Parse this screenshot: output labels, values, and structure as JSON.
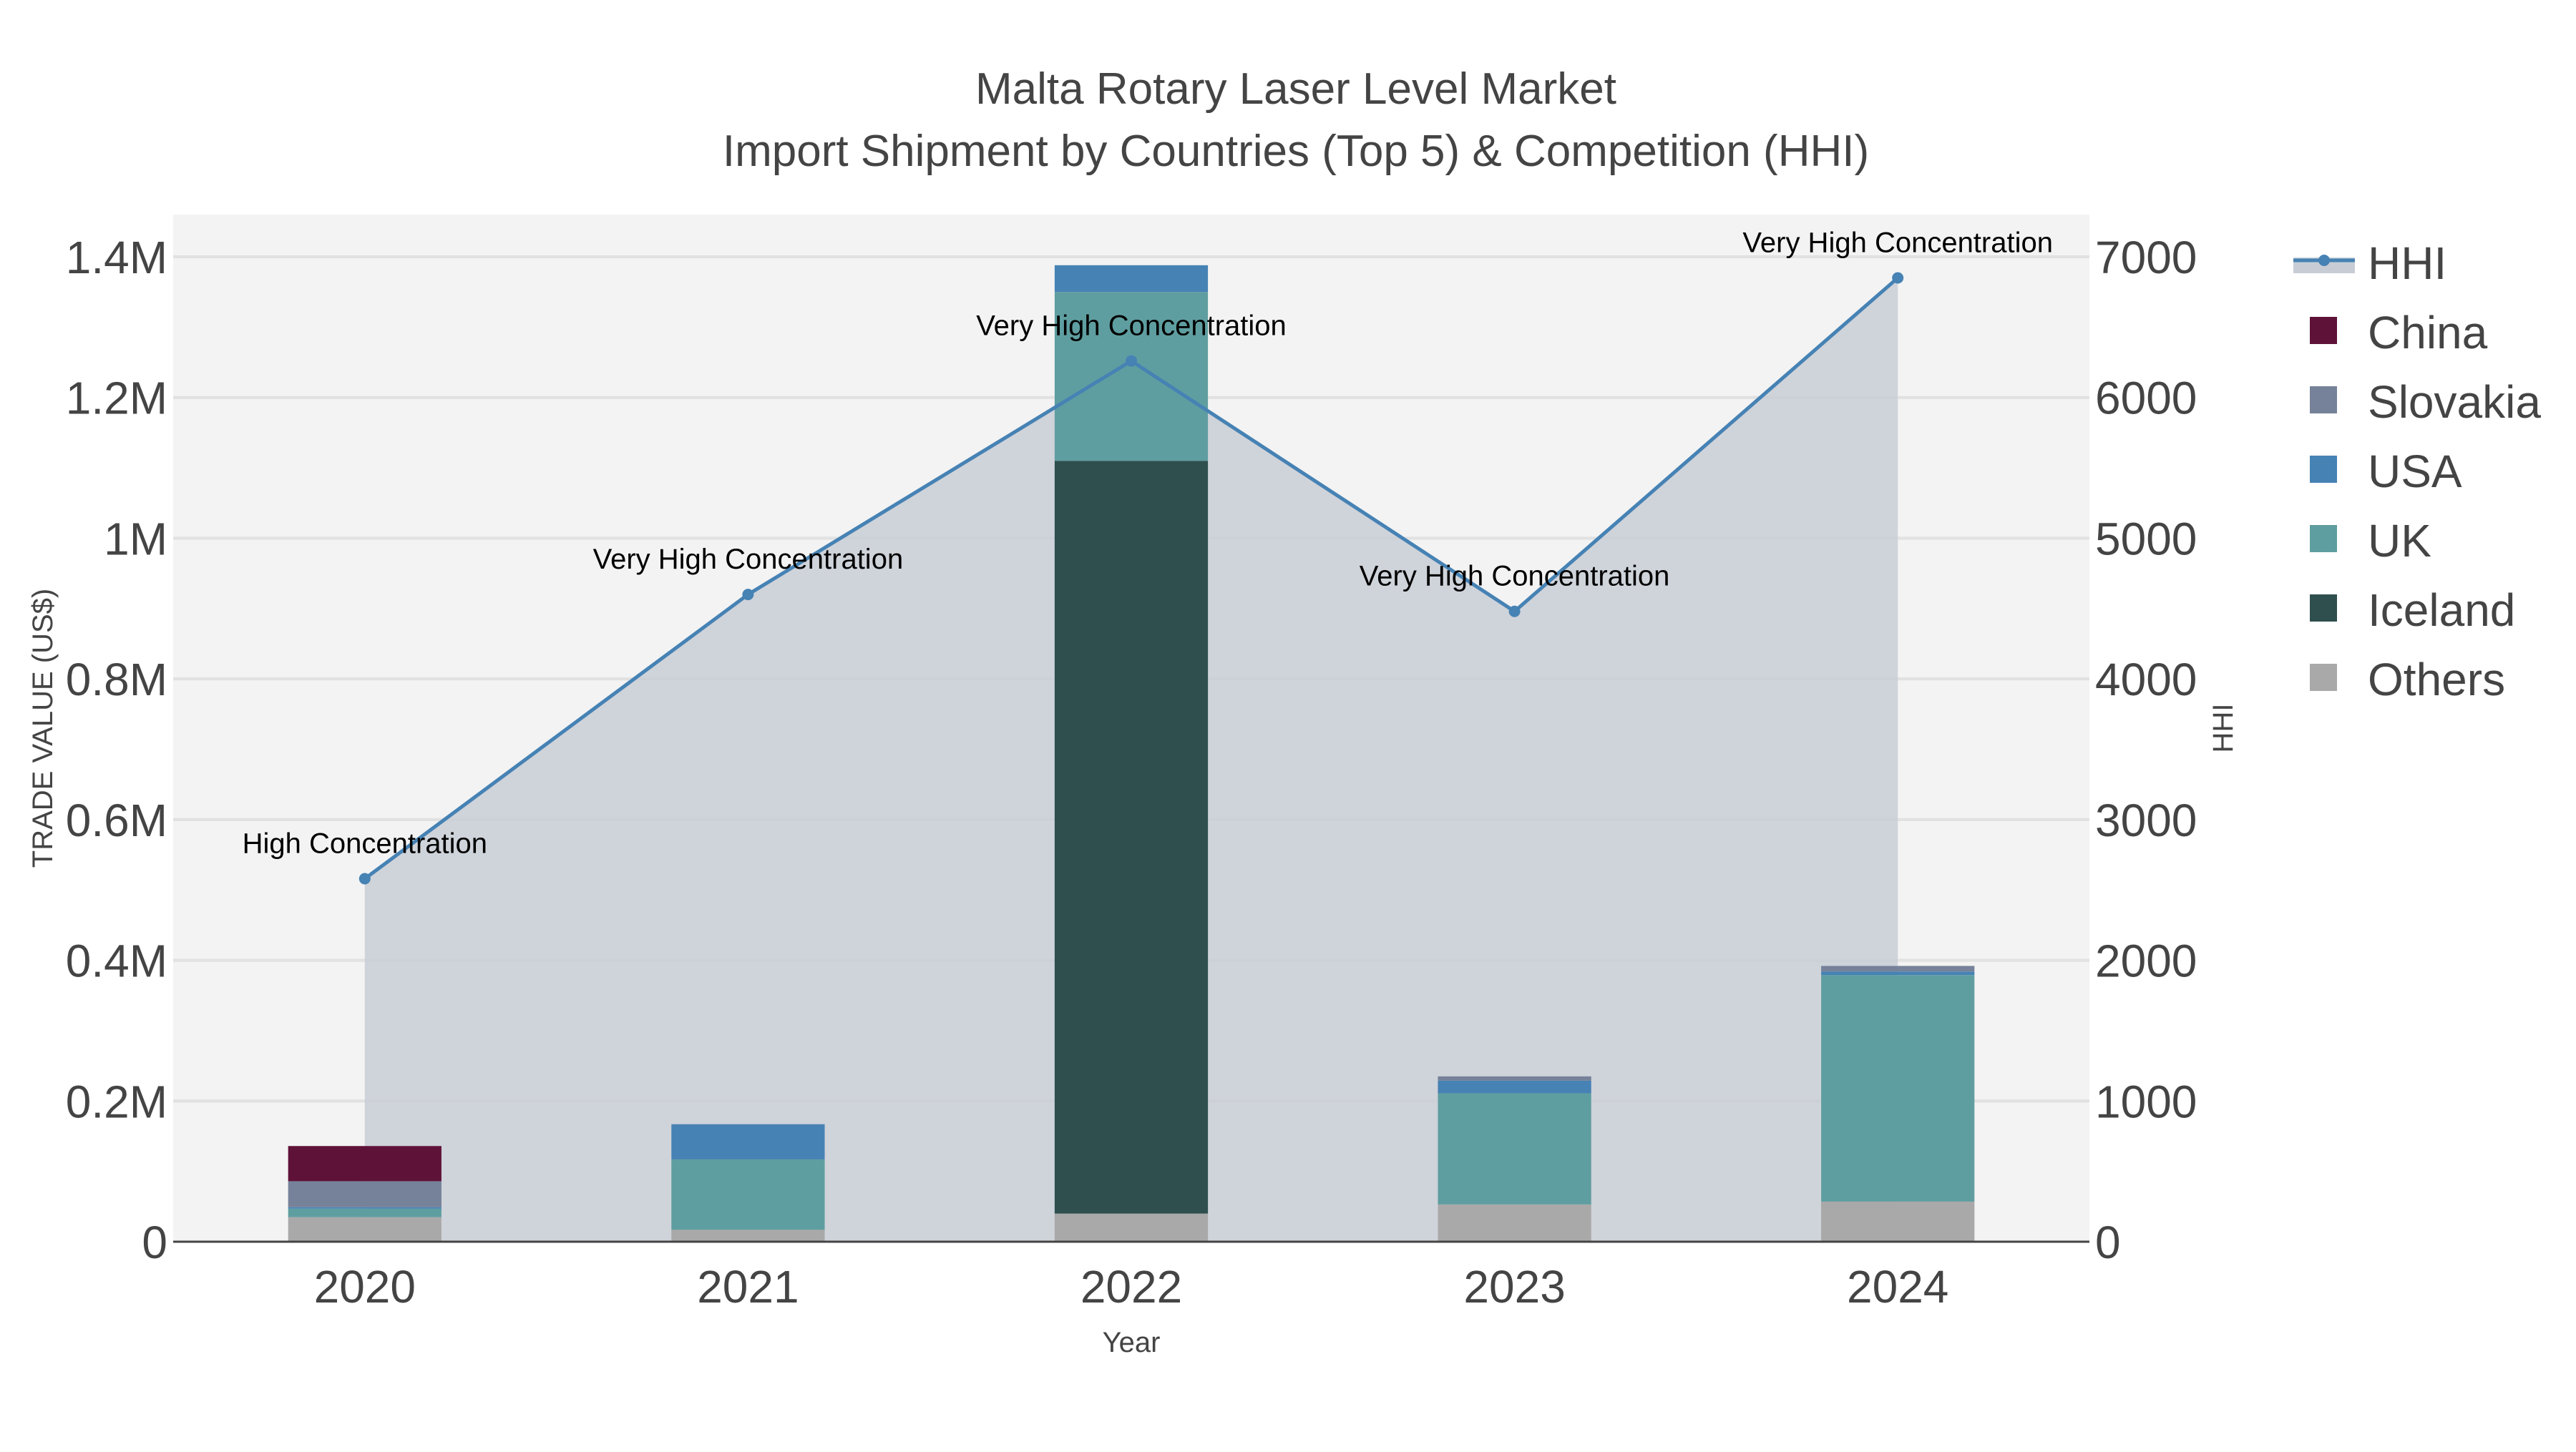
{
  "chart_data": {
    "type": "bar",
    "title": "Malta Rotary Laser Level Market",
    "subtitle": "Import Shipment by Countries (Top 5) & Competition (HHI)",
    "xlabel": "Year",
    "ylabel": "TRADE VALUE (US$)",
    "y2label": "HHI",
    "categories": [
      "2020",
      "2021",
      "2022",
      "2023",
      "2024"
    ],
    "ylim": [
      0,
      1460000
    ],
    "y2lim": [
      0,
      7300
    ],
    "y_ticks": [
      0,
      200000,
      400000,
      600000,
      800000,
      1000000,
      1200000,
      1400000
    ],
    "y_tick_labels": [
      "0",
      "0.2M",
      "0.4M",
      "0.6M",
      "0.8M",
      "1M",
      "1.2M",
      "1.4M"
    ],
    "y2_ticks": [
      0,
      1000,
      2000,
      3000,
      4000,
      5000,
      6000,
      7000
    ],
    "y2_tick_labels": [
      "0",
      "1000",
      "2000",
      "3000",
      "4000",
      "5000",
      "6000",
      "7000"
    ],
    "legend_position": "right",
    "grid": true,
    "stack_order_bottom_to_top": [
      "Others",
      "Iceland",
      "UK",
      "USA",
      "Slovakia",
      "China"
    ],
    "series": [
      {
        "name": "China",
        "color": "#5f1238",
        "values": [
          50000,
          0,
          0,
          0,
          0
        ]
      },
      {
        "name": "Slovakia",
        "color": "#768299",
        "values": [
          37000,
          0,
          0,
          6000,
          8000
        ]
      },
      {
        "name": "USA",
        "color": "#4682b4",
        "values": [
          2000,
          50000,
          38000,
          18000,
          5000
        ]
      },
      {
        "name": "UK",
        "color": "#5f9ea0",
        "values": [
          12000,
          100000,
          240000,
          158000,
          322000
        ]
      },
      {
        "name": "Iceland",
        "color": "#2f4f4f",
        "values": [
          0,
          0,
          1070000,
          0,
          0
        ]
      },
      {
        "name": "Others",
        "color": "#a9a9a9",
        "values": [
          35000,
          17000,
          40000,
          53000,
          57000
        ]
      }
    ],
    "hhi": {
      "name": "HHI",
      "color": "#4682b4",
      "fill": "#c8cdd5",
      "values": [
        2580,
        4600,
        6260,
        4480,
        6850
      ],
      "annotations": [
        "High Concentration",
        "Very High Concentration",
        "Very High Concentration",
        "Very High Concentration",
        "Very High Concentration"
      ]
    }
  }
}
